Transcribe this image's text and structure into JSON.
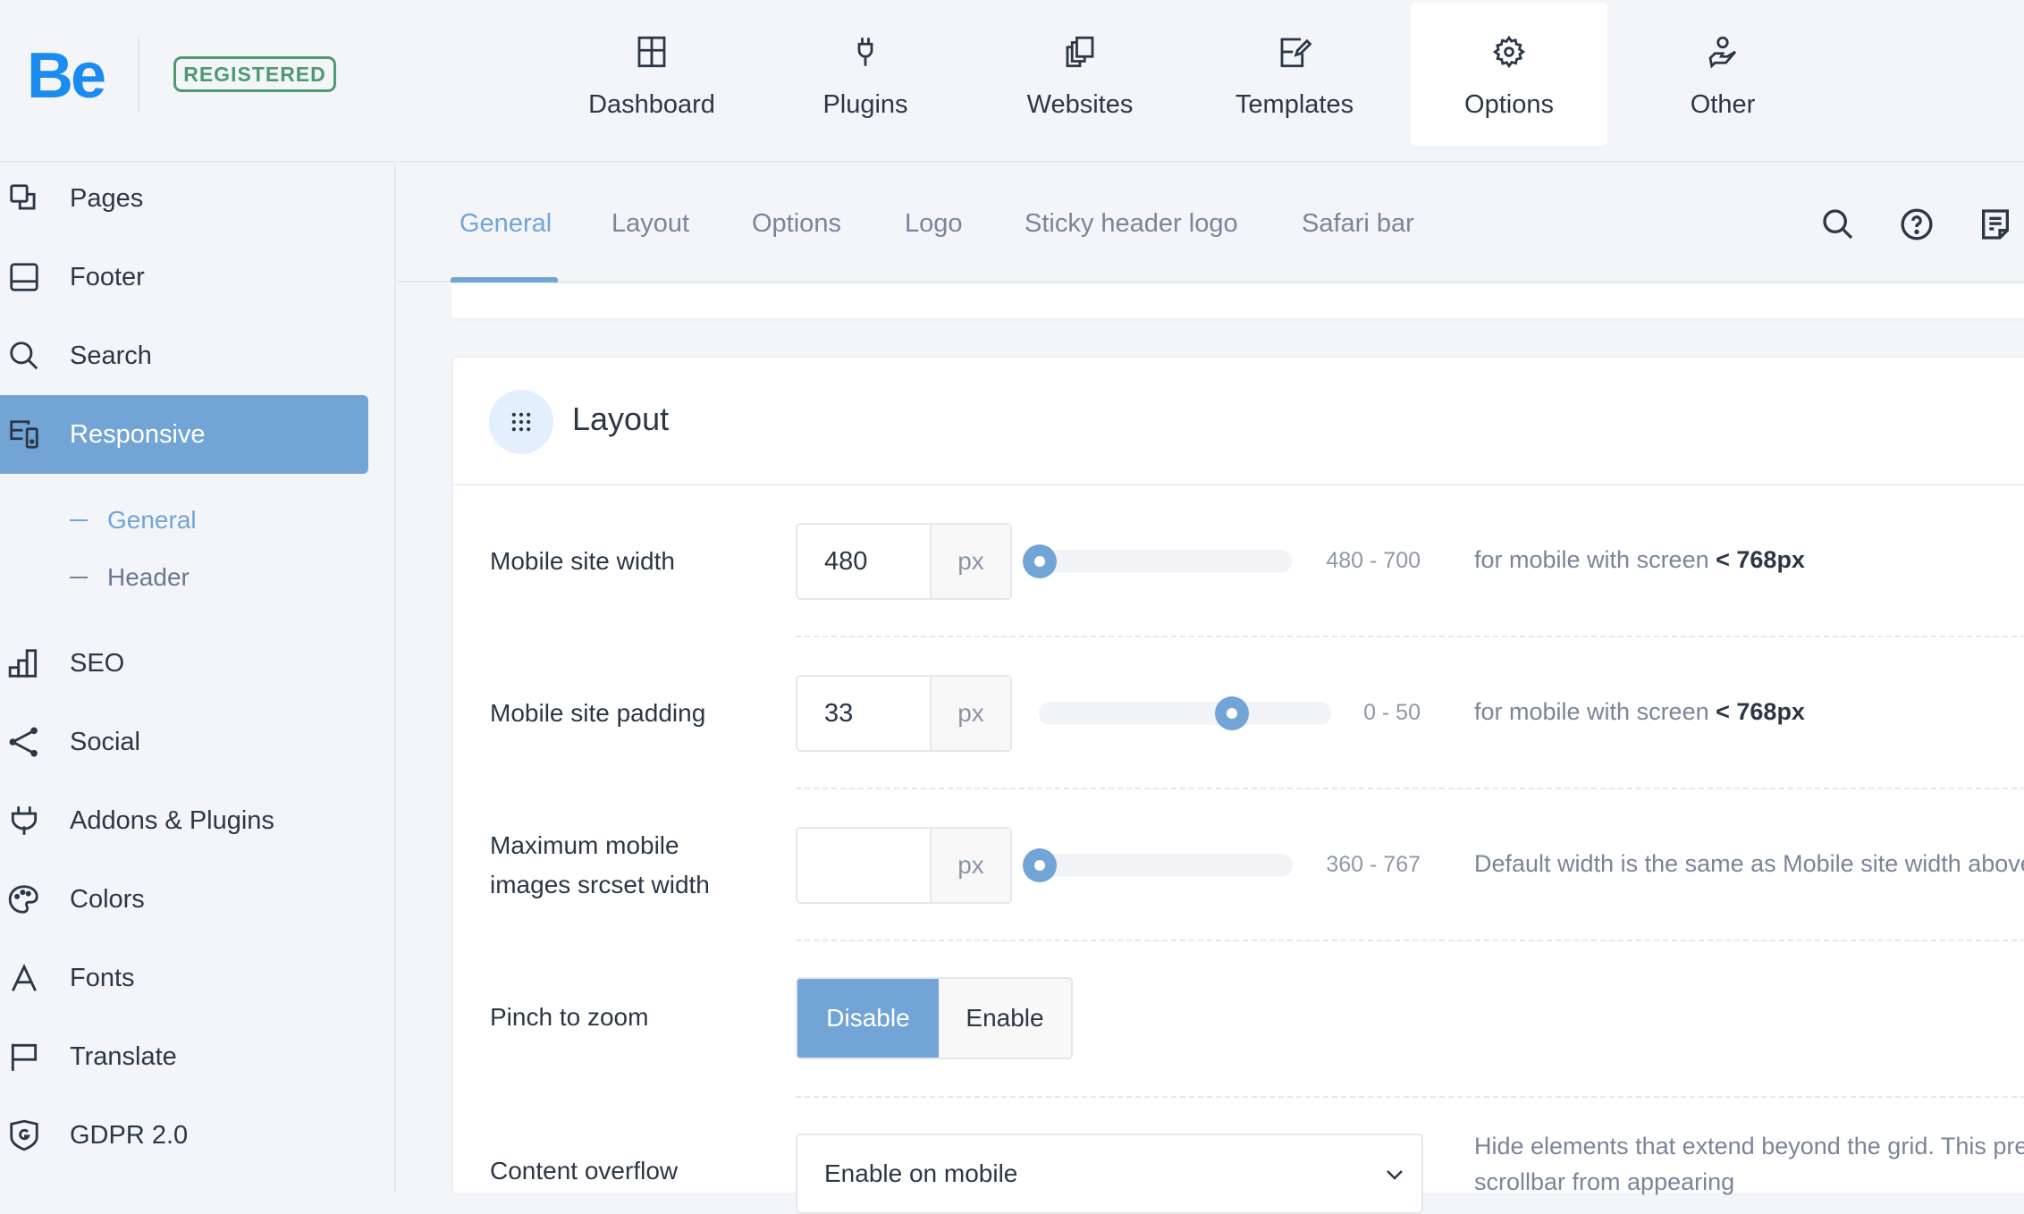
{
  "header": {
    "logo": "Be",
    "badge": "REGISTERED",
    "nav": [
      {
        "label": "Dashboard",
        "icon": "dashboard-icon"
      },
      {
        "label": "Plugins",
        "icon": "plug-icon"
      },
      {
        "label": "Websites",
        "icon": "websites-icon"
      },
      {
        "label": "Templates",
        "icon": "templates-icon"
      },
      {
        "label": "Options",
        "icon": "gear-icon",
        "active": true
      },
      {
        "label": "Other",
        "icon": "hand-user-icon"
      }
    ]
  },
  "sidebar": {
    "items": [
      {
        "label": "Pages",
        "icon": "pages-icon"
      },
      {
        "label": "Footer",
        "icon": "footer-icon"
      },
      {
        "label": "Search",
        "icon": "search-icon"
      },
      {
        "label": "Responsive",
        "icon": "responsive-icon",
        "active": true
      },
      {
        "label": "SEO",
        "icon": "seo-icon"
      },
      {
        "label": "Social",
        "icon": "share-icon"
      },
      {
        "label": "Addons & Plugins",
        "icon": "plug-icon"
      },
      {
        "label": "Colors",
        "icon": "palette-icon"
      },
      {
        "label": "Fonts",
        "icon": "font-icon"
      },
      {
        "label": "Translate",
        "icon": "flag-icon"
      },
      {
        "label": "GDPR 2.0",
        "icon": "shield-g-icon"
      }
    ],
    "subitems": [
      {
        "label": "General",
        "active": true
      },
      {
        "label": "Header"
      }
    ]
  },
  "subtabs": {
    "tabs": [
      {
        "label": "General",
        "active": true
      },
      {
        "label": "Layout"
      },
      {
        "label": "Options"
      },
      {
        "label": "Logo"
      },
      {
        "label": "Sticky header logo"
      },
      {
        "label": "Safari bar"
      }
    ],
    "tools": [
      "search-icon",
      "help-icon",
      "notes-icon"
    ]
  },
  "card": {
    "title": "Layout",
    "icon": "grid-dots-icon",
    "rows": {
      "mobile_width": {
        "label": "Mobile site width",
        "value": "480",
        "unit": "px",
        "min": 480,
        "max": 700,
        "range_text": "480 - 700",
        "desc": "for mobile with screen",
        "desc_bold": "< 768px"
      },
      "mobile_padding": {
        "label": "Mobile site padding",
        "value": "33",
        "unit": "px",
        "min": 0,
        "max": 50,
        "range_text": "0 - 50",
        "desc": "for mobile with screen",
        "desc_bold": "< 768px"
      },
      "srcset_width": {
        "label_line1": "Maximum mobile",
        "label_line2": "images srcset width",
        "value": "",
        "unit": "px",
        "min": 360,
        "max": 767,
        "range_text": "360 - 767",
        "desc": "Default width is the same as Mobile site width above"
      },
      "pinch_zoom": {
        "label": "Pinch to zoom",
        "options": [
          "Disable",
          "Enable"
        ],
        "selected": "Disable"
      },
      "content_overflow": {
        "label": "Content overflow",
        "selected": "Enable on mobile",
        "desc_line1": "Hide elements that extend beyond the grid. This prevents the",
        "desc_line2": "scrollbar from appearing"
      }
    }
  },
  "colors": {
    "accent": "#72a5d6",
    "brand": "#1a8cf0",
    "registered": "#4f9a72",
    "text": "#2c3746",
    "muted": "#7a8599"
  }
}
